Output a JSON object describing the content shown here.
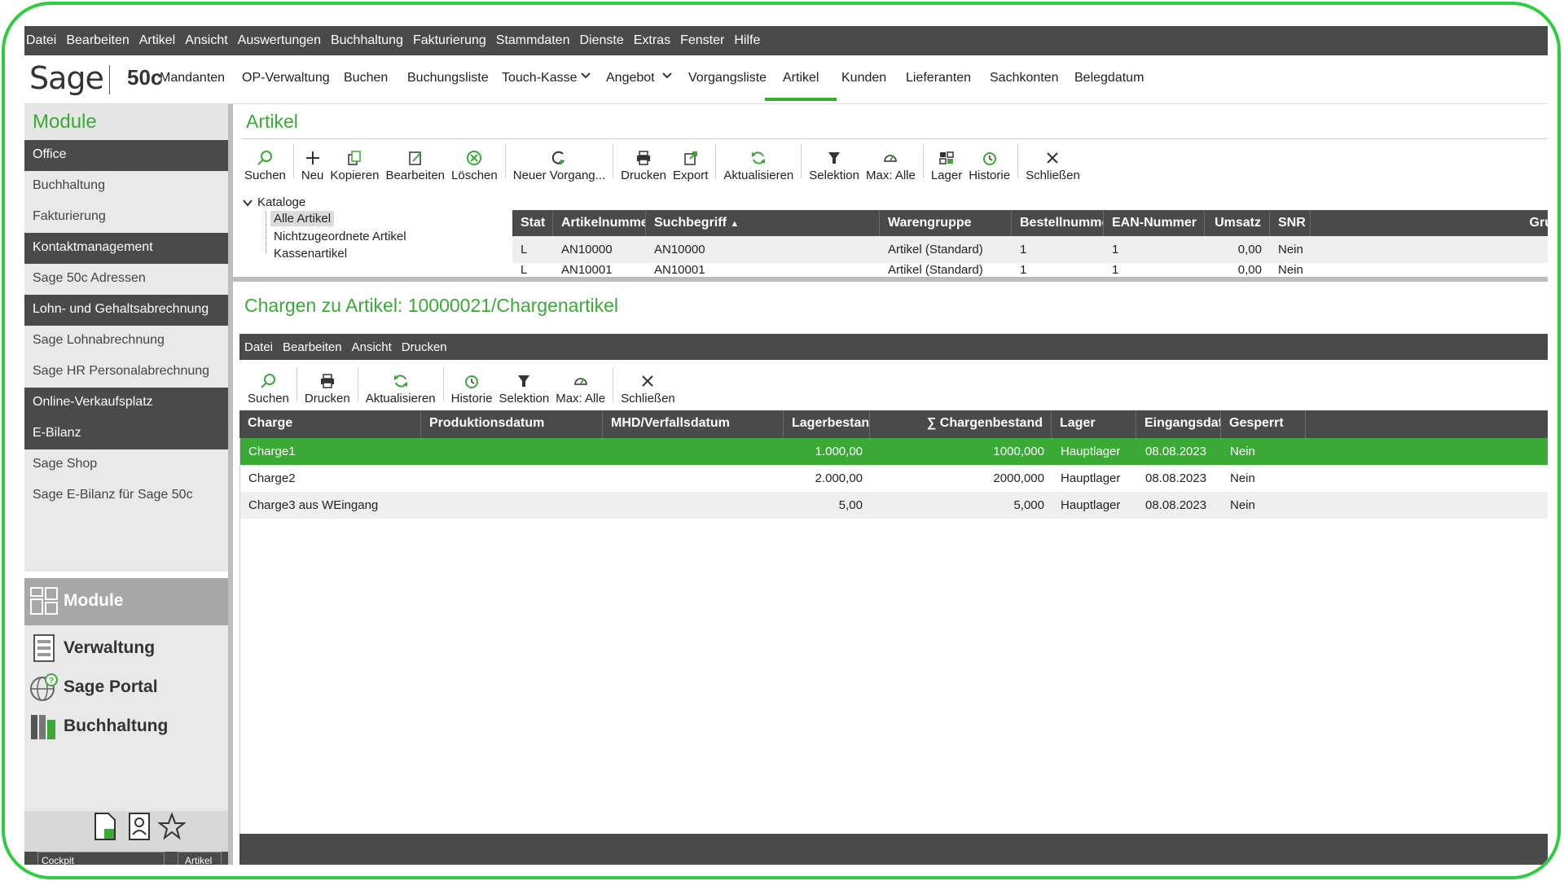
{
  "menubar": [
    "Datei",
    "Bearbeiten",
    "Artikel",
    "Ansicht",
    "Auswertungen",
    "Buchhaltung",
    "Fakturierung",
    "Stammdaten",
    "Dienste",
    "Extras",
    "Fenster",
    "Hilfe"
  ],
  "ribbon": {
    "logo": "Sage",
    "product": "50c",
    "tabs": [
      "Mandanten",
      "OP-Verwaltung",
      "Buchen",
      "Buchungsliste",
      "Touch-Kasse",
      "Angebot",
      "Vorgangsliste",
      "Artikel",
      "Kunden",
      "Lieferanten",
      "Sachkonten",
      "Belegdatum"
    ],
    "active_tab": "Artikel"
  },
  "sidebar": {
    "title": "Module",
    "items": [
      {
        "label": "Office",
        "type": "group"
      },
      {
        "label": "Buchhaltung",
        "type": "sub"
      },
      {
        "label": "Fakturierung",
        "type": "sub"
      },
      {
        "label": "Kontaktmanagement",
        "type": "group"
      },
      {
        "label": "Sage 50c Adressen",
        "type": "sub"
      },
      {
        "label": "Lohn- und Gehaltsabrechnung",
        "type": "group"
      },
      {
        "label": "Sage Lohnabrechnung",
        "type": "sub"
      },
      {
        "label": "Sage HR Personalabrechnung",
        "type": "sub"
      },
      {
        "label": "Online-Verkaufsplatz",
        "type": "group"
      },
      {
        "label": "E-Bilanz",
        "type": "group"
      },
      {
        "label": "Sage Shop",
        "type": "sub"
      },
      {
        "label": "Sage E-Bilanz für Sage 50c",
        "type": "sub"
      }
    ],
    "big_buttons": [
      {
        "label": "Module",
        "icon": "modules-icon"
      },
      {
        "label": "Verwaltung",
        "icon": "verwaltung-icon"
      },
      {
        "label": "Sage Portal",
        "icon": "portal-globe-icon"
      },
      {
        "label": "Buchhaltung",
        "icon": "books-icon"
      }
    ],
    "cockpit": "Cockpit",
    "artikel": "Artikel"
  },
  "artikel": {
    "title": "Artikel",
    "toolbar": [
      "Suchen",
      "Neu",
      "Kopieren",
      "Bearbeiten",
      "Löschen",
      "Neuer Vorgang...",
      "Drucken",
      "Export",
      "Aktualisieren",
      "Selektion",
      "Max: Alle",
      "Lager",
      "Historie",
      "Schließen"
    ],
    "tree": {
      "root": "Kataloge",
      "children": [
        "Alle Artikel",
        "Nichtzugeordnete Artikel",
        "Kassenartikel"
      ],
      "selected": "Alle Artikel"
    },
    "columns": [
      "Stat",
      "Artikelnumme",
      "Suchbegriff",
      "Warengruppe",
      "Bestellnumme",
      "EAN-Nummer",
      "Umsatz",
      "SNR",
      "Gru"
    ],
    "rows": [
      [
        "L",
        "AN10000",
        "AN10000",
        "Artikel (Standard)",
        "1",
        "1",
        "0,00",
        "Nein",
        ""
      ],
      [
        "L",
        "AN10001",
        "AN10001",
        "Artikel (Standard)",
        "1",
        "1",
        "0,00",
        "Nein",
        ""
      ]
    ]
  },
  "chargen": {
    "title": "Chargen zu Artikel: 10000021/Chargenartikel",
    "menu": [
      "Datei",
      "Bearbeiten",
      "Ansicht",
      "Drucken"
    ],
    "toolbar": [
      "Suchen",
      "Drucken",
      "Aktualisieren",
      "Historie",
      "Selektion",
      "Max: Alle",
      "Schließen"
    ],
    "columns": [
      "Charge",
      "Produktionsdatum",
      "MHD/Verfallsdatum",
      "Lagerbestan",
      "∑ Chargenbestand",
      "Lager",
      "Eingangsdat",
      "Gesperrt"
    ],
    "rows": [
      [
        "Charge1",
        "",
        "",
        "1.000,00",
        "1000,000",
        "Hauptlager",
        "08.08.2023",
        "Nein"
      ],
      [
        "Charge2",
        "",
        "",
        "2.000,00",
        "2000,000",
        "Hauptlager",
        "08.08.2023",
        "Nein"
      ],
      [
        "Charge3 aus WEingang",
        "",
        "",
        "5,00",
        "5,000",
        "Hauptlager",
        "08.08.2023",
        "Nein"
      ]
    ],
    "selected_row": 0
  },
  "colors": {
    "accent": "#3aa935",
    "dark": "#4a4a4a",
    "frame": "#2ecc40"
  }
}
